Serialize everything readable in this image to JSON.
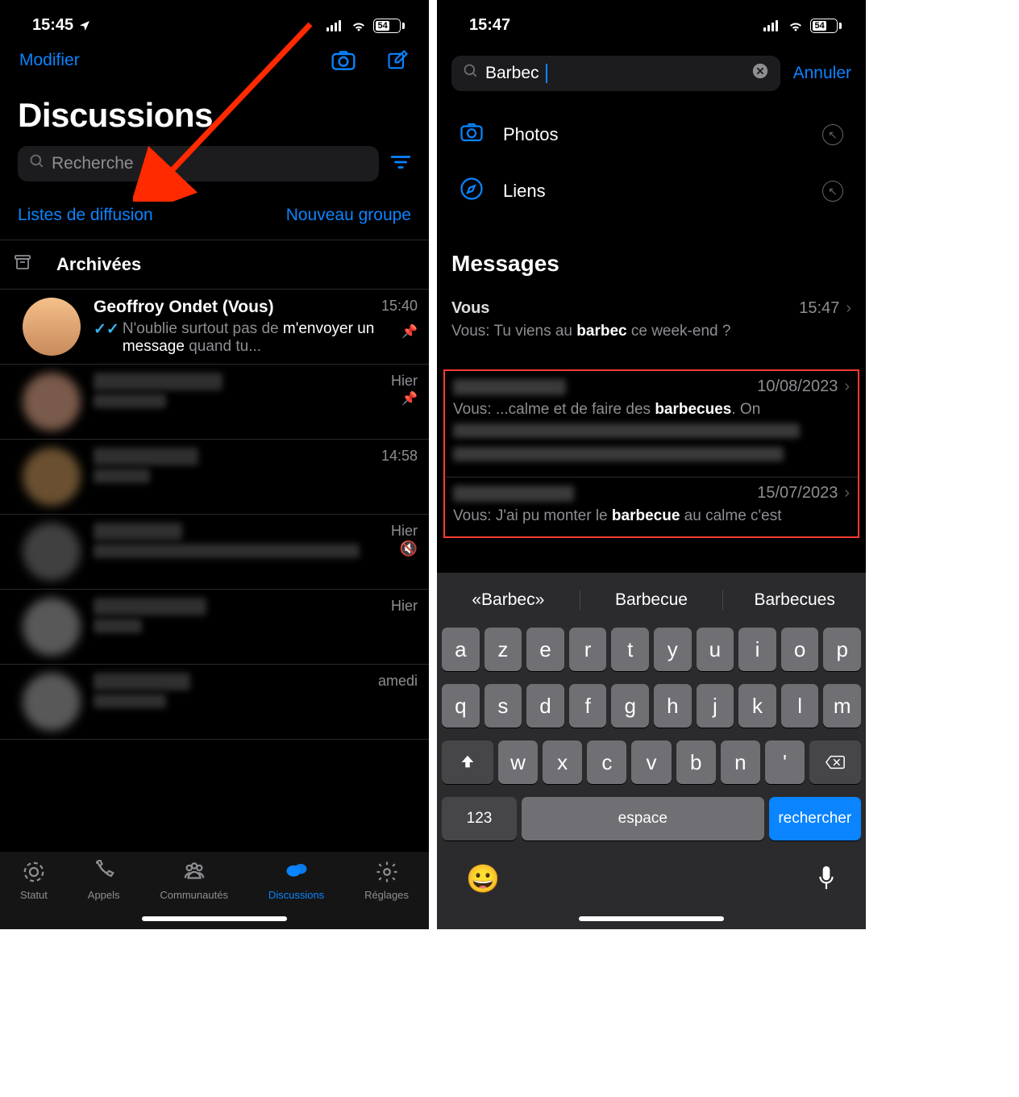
{
  "left": {
    "status": {
      "time": "15:45",
      "battery": "54"
    },
    "nav": {
      "edit": "Modifier"
    },
    "title": "Discussions",
    "search_placeholder": "Recherche",
    "links": {
      "broadcast": "Listes de diffusion",
      "newgroup": "Nouveau groupe"
    },
    "archived": "Archivées",
    "chats": [
      {
        "name": "Geoffroy Ondet (Vous)",
        "time": "15:40",
        "msg_prefix": "N'oublie surtout pas de ",
        "msg_bold": "m'envoyer un message",
        "msg_suffix": " quand tu...",
        "pinned": true,
        "ticks": true
      },
      {
        "name_blur": true,
        "time": "Hier",
        "pinned": true
      },
      {
        "name_blur": true,
        "time": "14:58"
      },
      {
        "name_blur": true,
        "time": "Hier",
        "muted": true
      },
      {
        "name_blur": true,
        "time": "Hier"
      },
      {
        "name_blur": true,
        "time": "amedi"
      }
    ],
    "tabs": {
      "statut": "Statut",
      "appels": "Appels",
      "comm": "Communautés",
      "disc": "Discussions",
      "reglages": "Réglages"
    }
  },
  "right": {
    "status": {
      "time": "15:47",
      "battery": "54"
    },
    "search_query": "Barbec",
    "cancel": "Annuler",
    "filters": {
      "photos": "Photos",
      "liens": "Liens"
    },
    "section": "Messages",
    "results": [
      {
        "name": "Vous",
        "date": "15:47",
        "body_pre": "Vous: Tu viens au ",
        "body_hl": "barbec",
        "body_post": " ce week-end ?"
      },
      {
        "name_blur": true,
        "date": "10/08/2023",
        "body_pre": "Vous: ...calme et de faire des ",
        "body_hl": "barbecues",
        "body_post": ". On",
        "extra_blur": 2
      },
      {
        "name_blur": true,
        "date": "15/07/2023",
        "body_pre": "Vous: J'ai pu monter le ",
        "body_hl": "barbecue",
        "body_post": " au calme c'est"
      }
    ],
    "suggestions": [
      "«Barbec»",
      "Barbecue",
      "Barbecues"
    ],
    "kb_rows": [
      [
        "a",
        "z",
        "e",
        "r",
        "t",
        "y",
        "u",
        "i",
        "o",
        "p"
      ],
      [
        "q",
        "s",
        "d",
        "f",
        "g",
        "h",
        "j",
        "k",
        "l",
        "m"
      ],
      [
        "⇧",
        "w",
        "x",
        "c",
        "v",
        "b",
        "n",
        "'",
        "⌫"
      ]
    ],
    "kb_bottom": {
      "num": "123",
      "space": "espace",
      "search": "rechercher"
    }
  }
}
